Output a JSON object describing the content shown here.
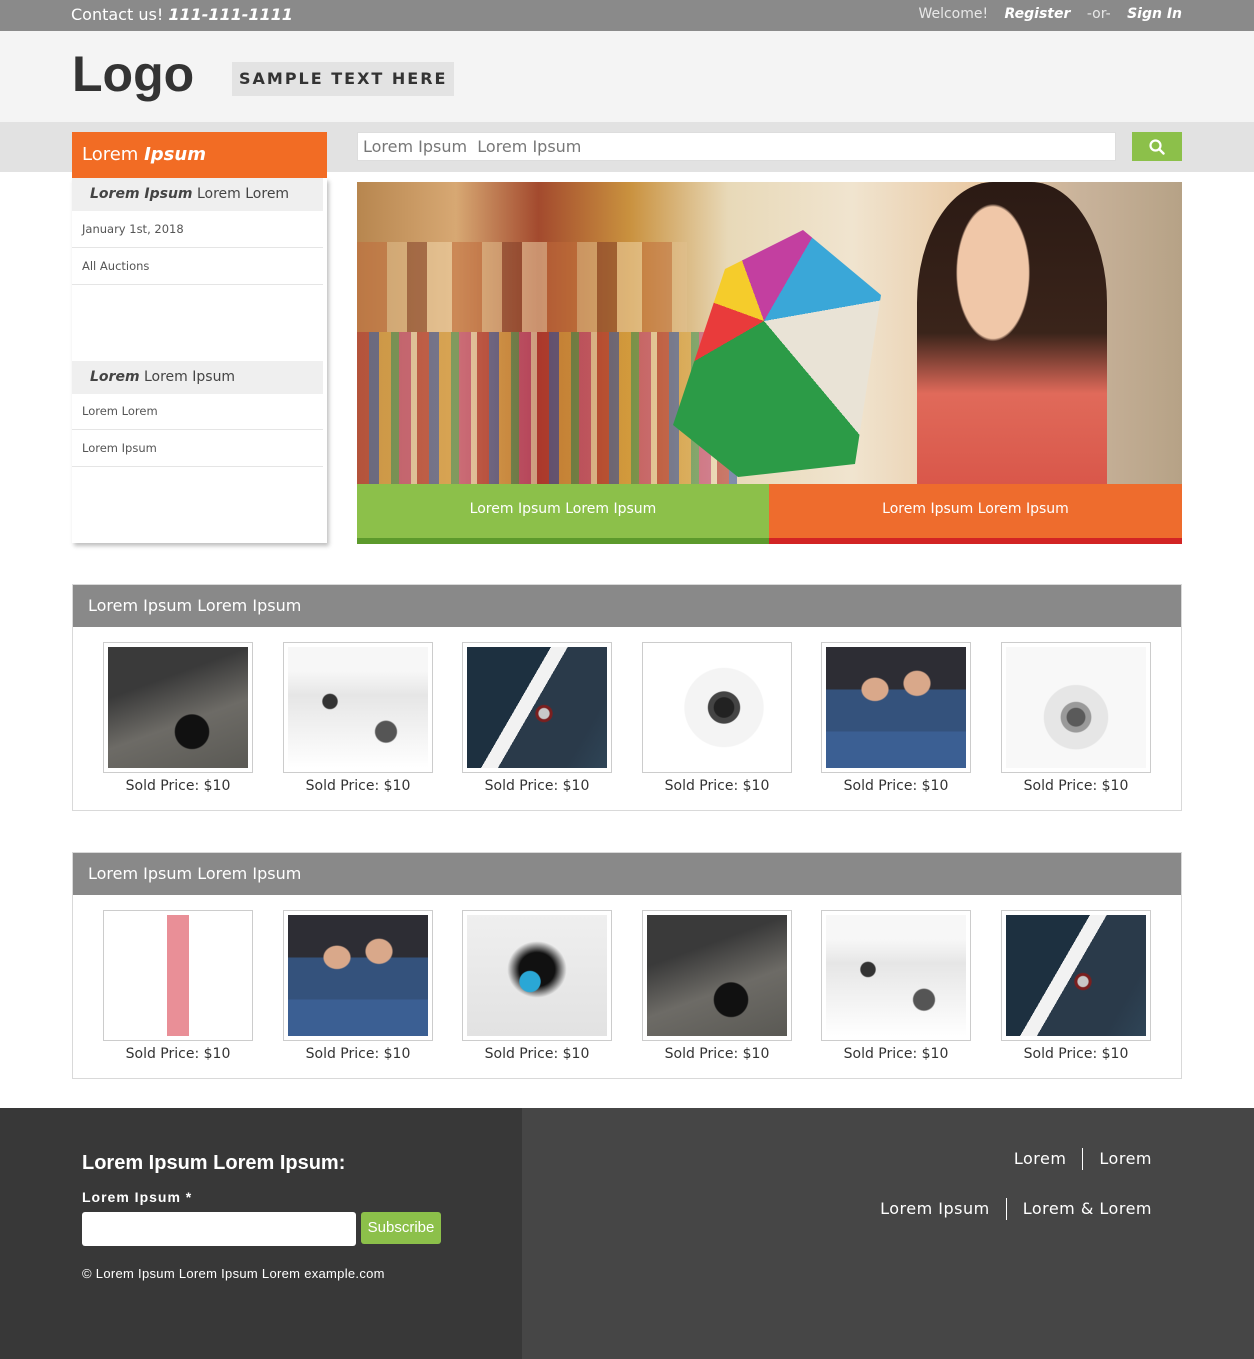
{
  "topbar": {
    "contact_label": "Contact us!",
    "phone": "111-111-1111",
    "welcome": "Welcome!",
    "register": "Register",
    "or": "-or-",
    "sign_in": "Sign In"
  },
  "header": {
    "logo": "Logo",
    "tagline": "SAMPLE TEXT HERE"
  },
  "sidebar": {
    "title_plain": "Lorem",
    "title_emph": "Ipsum",
    "section1": {
      "emph": "Lorem Ipsum",
      "plain": "Lorem Lorem"
    },
    "section1_items": [
      "January 1st, 2018",
      "All Auctions"
    ],
    "section2": {
      "emph": "Lorem",
      "plain": "Lorem Ipsum"
    },
    "section2_items": [
      "Lorem Lorem",
      "Lorem Ipsum"
    ]
  },
  "search": {
    "value": "Lorem Ipsum  Lorem Ipsum",
    "icon": "search-icon"
  },
  "hero": {
    "cta_left": "Lorem Ipsum Lorem Ipsum",
    "cta_right": "Lorem Ipsum Lorem Ipsum"
  },
  "panels": [
    {
      "title": "Lorem Ipsum Lorem Ipsum",
      "products": [
        {
          "image": "high-heels",
          "price": "Sold Price: $10"
        },
        {
          "image": "alarm-kit",
          "price": "Sold Price: $10"
        },
        {
          "image": "wristwatch",
          "price": "Sold Price: $10"
        },
        {
          "image": "ip-camera",
          "price": "Sold Price: $10"
        },
        {
          "image": "fashion-couple",
          "price": "Sold Price: $10"
        },
        {
          "image": "bullet-camera",
          "price": "Sold Price: $10"
        }
      ]
    },
    {
      "title": "Lorem Ipsum Lorem Ipsum",
      "products": [
        {
          "image": "pink-bottle",
          "price": "Sold Price: $10"
        },
        {
          "image": "fashion-couple",
          "price": "Sold Price: $10"
        },
        {
          "image": "blue-cable",
          "price": "Sold Price: $10"
        },
        {
          "image": "high-heels",
          "price": "Sold Price: $10"
        },
        {
          "image": "alarm-kit",
          "price": "Sold Price: $10"
        },
        {
          "image": "wristwatch",
          "price": "Sold Price: $10"
        }
      ]
    }
  ],
  "footer": {
    "title": "Lorem Ipsum Lorem Ipsum:",
    "field_label": "Lorem Ipsum *",
    "subscribe": "Subscribe",
    "copyright": "© Lorem Ipsum Lorem Ipsum Lorem example.com",
    "links_row1": [
      "Lorem",
      "Lorem"
    ],
    "links_row2": [
      "Lorem Ipsum",
      "Lorem & Lorem"
    ]
  },
  "colors": {
    "orange": "#f26c24",
    "green": "#8cc04a",
    "topbar": "#8a8a8a",
    "panel_header": "#898989",
    "footer_left": "#383838",
    "footer_right": "#464646"
  }
}
